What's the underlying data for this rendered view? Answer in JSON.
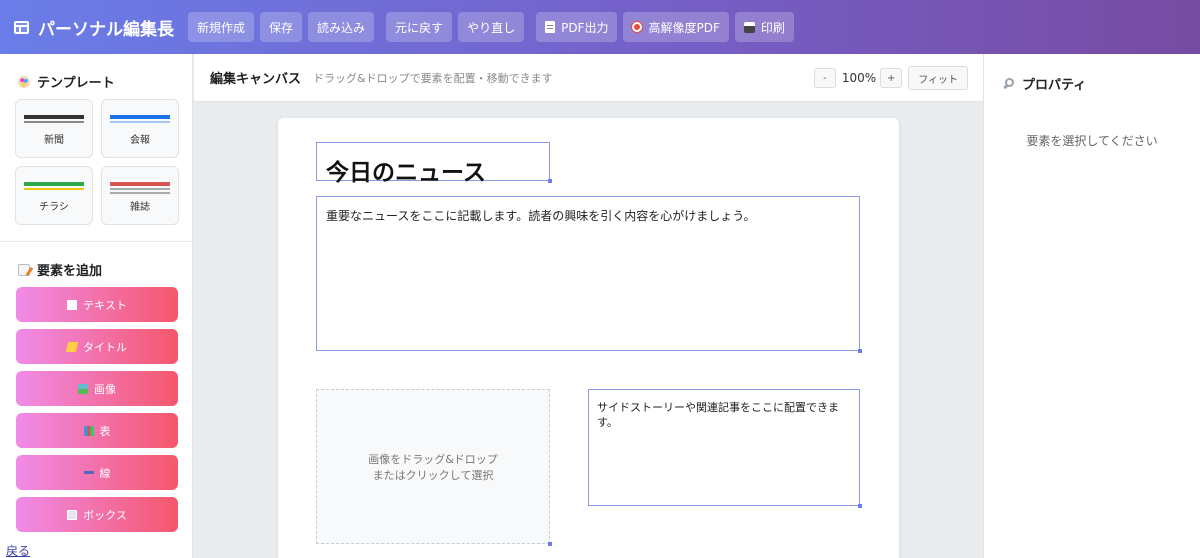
{
  "header": {
    "app_title": "パーソナル編集長",
    "buttons": {
      "new": "新規作成",
      "save": "保存",
      "load": "読み込み",
      "undo": "元に戻す",
      "redo": "やり直し",
      "pdf": "PDF出力",
      "hires_pdf": "高解像度PDF",
      "print": "印刷"
    }
  },
  "sidebar": {
    "templates_title": "テンプレート",
    "templates": [
      {
        "label": "新聞",
        "color": "#333333"
      },
      {
        "label": "会報",
        "color": "#1a73e8"
      },
      {
        "label": "チラシ",
        "color": "#2eaa4a"
      },
      {
        "label": "雑誌",
        "color": "#d9534f"
      }
    ],
    "add_title": "要素を追加",
    "add_items": [
      {
        "label": "テキスト",
        "icon": "document-icon"
      },
      {
        "label": "タイトル",
        "icon": "pencil-icon"
      },
      {
        "label": "画像",
        "icon": "image-icon"
      },
      {
        "label": "表",
        "icon": "chart-icon"
      },
      {
        "label": "線",
        "icon": "line-icon"
      },
      {
        "label": "ボックス",
        "icon": "box-icon"
      }
    ],
    "back_link": "戻る"
  },
  "canvas": {
    "title": "編集キャンバス",
    "hint": "ドラッグ&ドロップで要素を配置・移動できます",
    "zoom_out": "-",
    "zoom_level": "100%",
    "zoom_in": "+",
    "fit": "フィット",
    "elements": {
      "title_text": "今日のニュース",
      "body_text": "重要なニュースをここに記載します。読者の興味を引く内容を心がけましょう。",
      "image_placeholder": "画像をドラッグ&ドロップ\nまたはクリックして選択",
      "side_text": "サイドストーリーや関連記事をここに配置できます。"
    }
  },
  "properties": {
    "title": "プロパティ",
    "empty_message": "要素を選択してください"
  }
}
